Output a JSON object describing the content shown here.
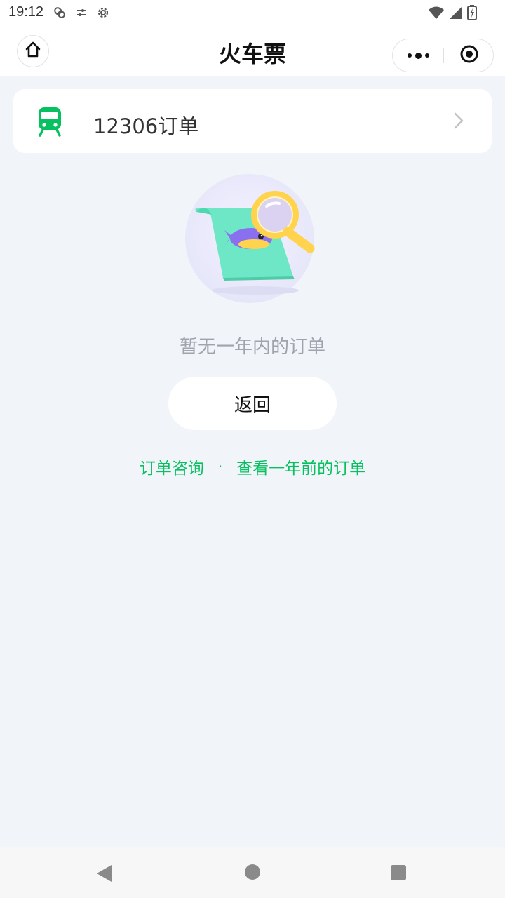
{
  "status_bar": {
    "time": "19:12",
    "left_icons": [
      "bandage-icon",
      "sliders-icon",
      "gear-icon"
    ],
    "right_icons": [
      "wifi-icon",
      "signal-icon",
      "battery-icon"
    ]
  },
  "header": {
    "title": "火车票",
    "home_icon": "home-icon",
    "more_icon": "more-dots-icon",
    "close_icon": "target-icon"
  },
  "order_entry": {
    "label": "12306订单",
    "icon": "train-icon",
    "accent": "#07c160"
  },
  "empty_state": {
    "message": "暂无一年内的订单",
    "back_label": "返回"
  },
  "links": {
    "consult": "订单咨询",
    "separator": "·",
    "older_orders": "查看一年前的订单",
    "color": "#07c160"
  },
  "nav_bar": {
    "icons": [
      "back-triangle-icon",
      "home-circle-icon",
      "recent-square-icon"
    ]
  }
}
